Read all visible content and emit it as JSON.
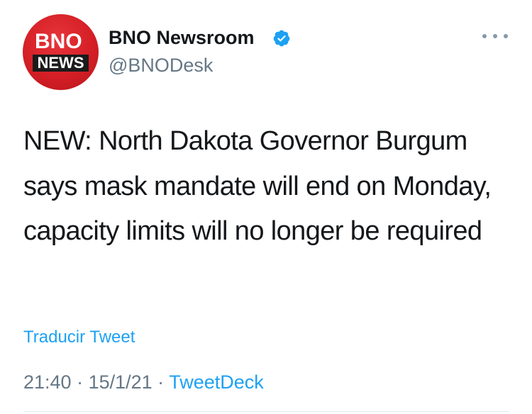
{
  "author": {
    "display_name": "BNO Newsroom",
    "handle": "@BNODesk",
    "verified": true,
    "avatar": {
      "line1": "BNO",
      "line2": "NEWS",
      "brand_color": "#d41f26"
    }
  },
  "tweet": {
    "text": "NEW: North Dakota Governor Burgum says mask mandate will end on Monday, capacity limits will no longer be required",
    "translate_label": "Traducir Tweet"
  },
  "meta": {
    "time": "21:40",
    "separator1": " · ",
    "date": "15/1/21",
    "separator2": " · ",
    "source": "TweetDeck"
  },
  "icons": {
    "verified": "verified-badge-icon",
    "more": "more-options-icon"
  },
  "colors": {
    "link": "#1da1f2",
    "secondary_text": "#657786",
    "primary_text": "#14171a"
  }
}
